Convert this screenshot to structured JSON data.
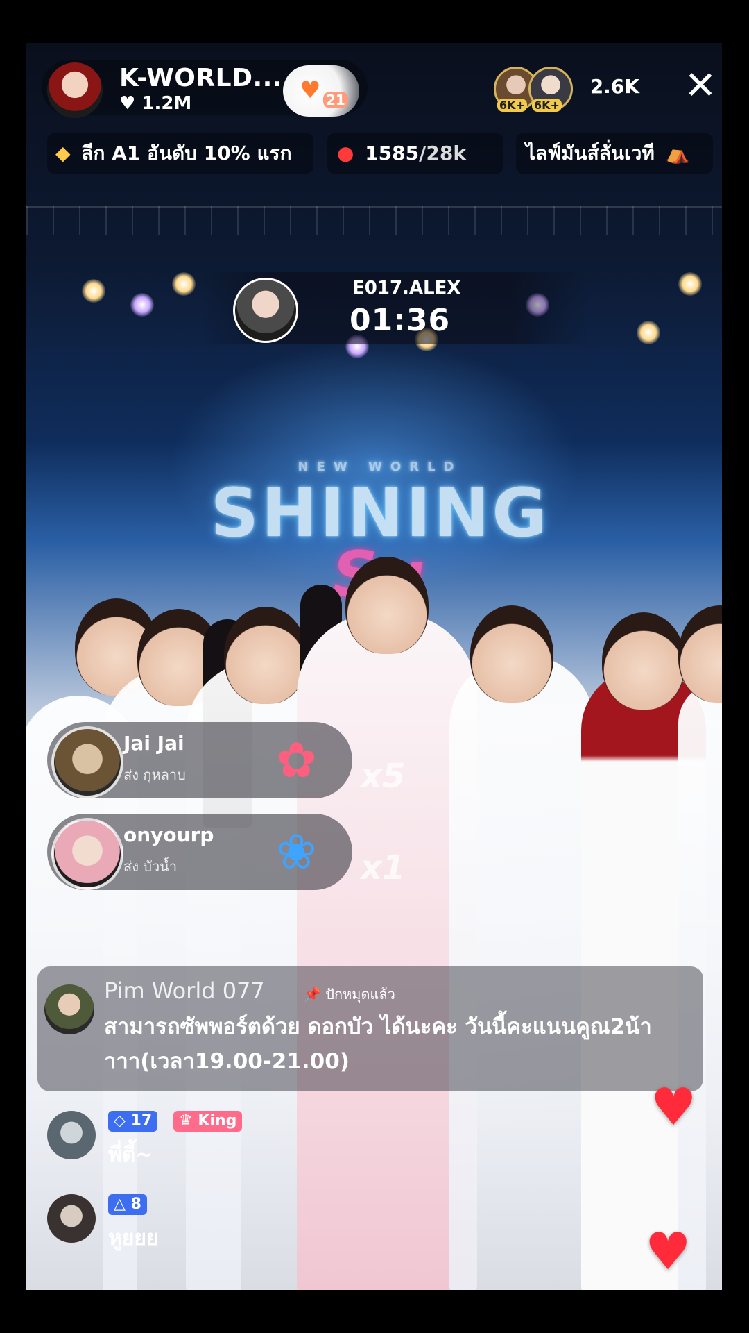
{
  "host": {
    "name": "K-WORLD...",
    "likes": "1.2M",
    "gift_badge_count": "21"
  },
  "viewers": {
    "badges": [
      "6K+",
      "6K+"
    ],
    "count": "2.6K"
  },
  "close_icon": "✕",
  "chips": {
    "league": "ลีก A1 อันดับ 10% แรก",
    "score_current": "1585",
    "score_target": "/28k",
    "event": "ไลฟ์มันส์ลั่นเวที"
  },
  "battle": {
    "name": "E017.ALEX",
    "timer": "01:36"
  },
  "stage": {
    "top": "NEW WORLD",
    "title": "SHINING",
    "subtitle": "Su"
  },
  "gifts": [
    {
      "user": "Jai Jai",
      "sub": "ส่ง กุหลาบ",
      "icon": "rose",
      "multiplier": "x5"
    },
    {
      "user": "onyourp",
      "sub": "ส่ง บัวน้ำ",
      "icon": "blue-lotus",
      "multiplier": "x1"
    }
  ],
  "pinned": {
    "user": "Pim World 077",
    "tag": "ปักหมุดแล้ว",
    "text": "สามารถซัพพอร์ตด้วย ดอกบัว ได้นะคะ วันนี้คะแนนคูณ2น้าาาา(เวลา19.00-21.00)"
  },
  "chat": [
    {
      "level": "17",
      "badge": "King",
      "text": "พี่ตี้~"
    },
    {
      "level": "8",
      "badge": "",
      "text": "หูยยย"
    }
  ],
  "colors": {
    "accent": "#ff2b3a",
    "gold": "#f1c94c",
    "level_blue": "#3d6df0",
    "king_pink": "#ff6b8a"
  }
}
